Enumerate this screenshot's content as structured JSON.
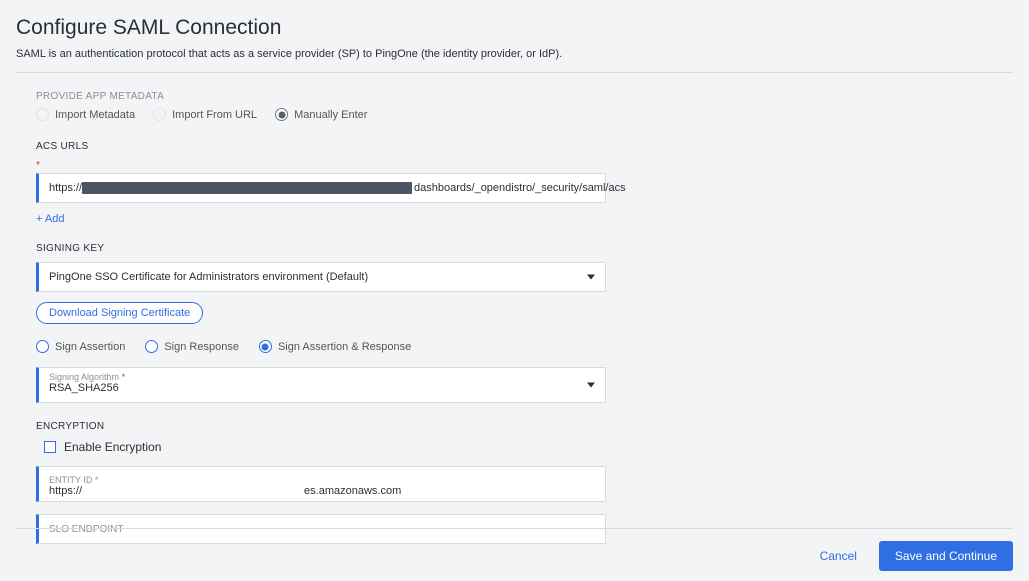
{
  "header": {
    "title": "Configure SAML Connection",
    "subtitle": "SAML is an authentication protocol that acts as a service provider (SP) to PingOne (the identity provider, or IdP)."
  },
  "metadata": {
    "label": "PROVIDE APP METADATA",
    "options": [
      {
        "label": "Import Metadata",
        "selected": false
      },
      {
        "label": "Import From URL",
        "selected": false
      },
      {
        "label": "Manually Enter",
        "selected": true
      }
    ]
  },
  "acs": {
    "label": "ACS URLS",
    "required_mark": "*",
    "prefix": "https://",
    "suffix": "dashboards/_opendistro/_security/saml/acs",
    "add_label": "+ Add"
  },
  "signing_key": {
    "label": "SIGNING KEY",
    "selected": "PingOne SSO Certificate for Administrators environment (Default)",
    "download_label": "Download Signing Certificate"
  },
  "sign_choice": {
    "options": [
      {
        "label": "Sign Assertion",
        "selected": false
      },
      {
        "label": "Sign Response",
        "selected": false
      },
      {
        "label": "Sign Assertion & Response",
        "selected": true
      }
    ]
  },
  "algo": {
    "float_label": "Signing Algorithm",
    "required_mark": "*",
    "value": "RSA_SHA256"
  },
  "encryption": {
    "label": "ENCRYPTION",
    "checkbox_label": "Enable Encryption",
    "checked": false
  },
  "entity": {
    "float_label": "ENTITY ID",
    "required_mark": "*",
    "prefix": "https://",
    "suffix": "es.amazonaws.com"
  },
  "slo": {
    "placeholder": "SLO ENDPOINT"
  },
  "footer": {
    "cancel": "Cancel",
    "save": "Save and Continue"
  }
}
